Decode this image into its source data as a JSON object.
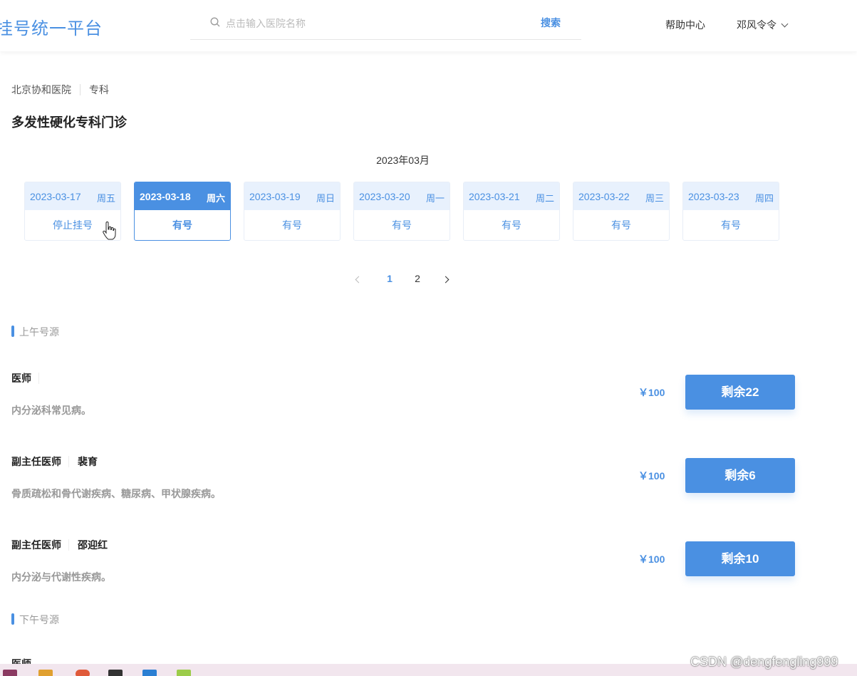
{
  "header": {
    "logo": "挂号统一平台",
    "search_placeholder": "点击输入医院名称",
    "search_button": "搜索",
    "help": "帮助中心",
    "user": "邓风令令"
  },
  "breadcrumb": {
    "hospital": "北京协和医院",
    "category": "专科"
  },
  "page_title": "多发性硬化专科门诊",
  "month": "2023年03月",
  "dates": [
    {
      "date": "2023-03-17",
      "weekday": "周五",
      "status": "停止挂号",
      "selected": false
    },
    {
      "date": "2023-03-18",
      "weekday": "周六",
      "status": "有号",
      "selected": true
    },
    {
      "date": "2023-03-19",
      "weekday": "周日",
      "status": "有号",
      "selected": false
    },
    {
      "date": "2023-03-20",
      "weekday": "周一",
      "status": "有号",
      "selected": false
    },
    {
      "date": "2023-03-21",
      "weekday": "周二",
      "status": "有号",
      "selected": false
    },
    {
      "date": "2023-03-22",
      "weekday": "周三",
      "status": "有号",
      "selected": false
    },
    {
      "date": "2023-03-23",
      "weekday": "周四",
      "status": "有号",
      "selected": false
    }
  ],
  "pagination": {
    "pages": [
      "1",
      "2"
    ],
    "current": "1"
  },
  "sections": {
    "morning": "上午号源",
    "afternoon": "下午号源"
  },
  "doctors": [
    {
      "title": "医师",
      "name": "",
      "desc": "内分泌科常见病。",
      "price": "￥100",
      "remain": "剩余22"
    },
    {
      "title": "副主任医师",
      "name": "裴育",
      "desc": "骨质疏松和骨代谢疾病、糖尿病、甲状腺疾病。",
      "price": "￥100",
      "remain": "剩余6"
    },
    {
      "title": "副主任医师",
      "name": "邵迎红",
      "desc": "内分泌与代谢性疾病。",
      "price": "￥100",
      "remain": "剩余10"
    }
  ],
  "afternoon_first_title": "医师",
  "watermark": "CSDN @dengfengling999",
  "colors": {
    "accent": "#4a90e2",
    "light_accent": "#e8f1fd"
  }
}
